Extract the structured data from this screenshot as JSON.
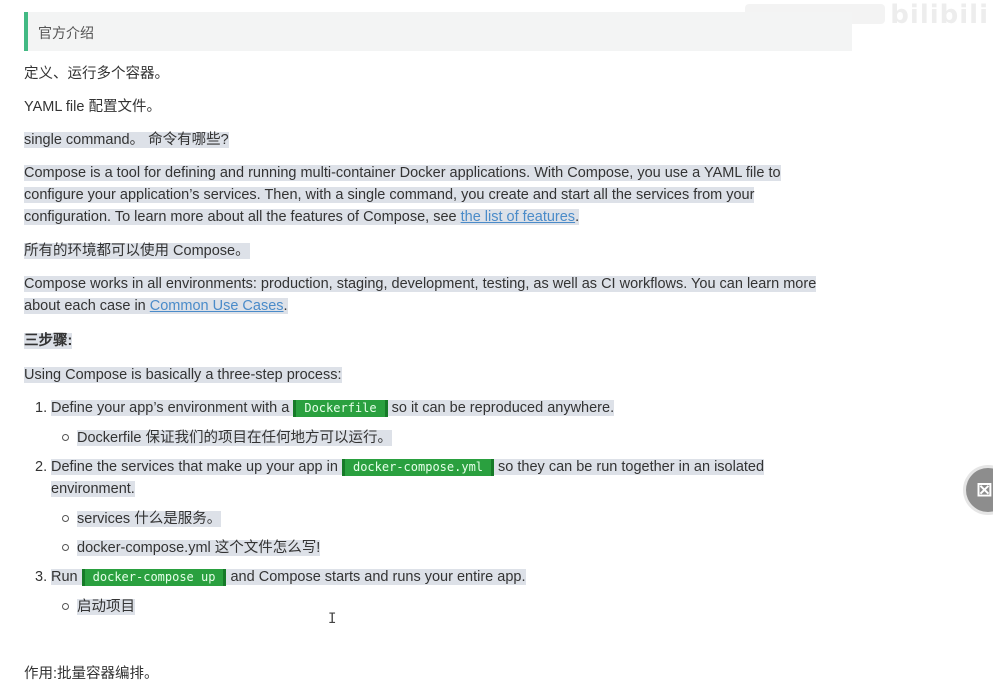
{
  "quote": "官方介绍",
  "p1": "定义、运行多个容器。",
  "p2": "YAML file 配置文件。",
  "p3": "single command。 命令有哪些?",
  "p4a": "Compose is a tool for defining and running multi-container Docker applications. With Compose, you use a YAML file to configure your application’s services. Then, with a single command, you create and start all the services from your configuration. To learn more about all the features of Compose, see ",
  "p4link": "the list of features",
  "p4b": ".",
  "p5": "所有的环境都可以使用 Compose。",
  "p6a": "Compose works in all environments: production, staging, development, testing, as well as CI workflows. You can learn more about each case in ",
  "p6link": "Common Use Cases",
  "p6b": ".",
  "h_steps": "三步骤:",
  "p7": "Using Compose is basically a three-step process:",
  "steps": [
    {
      "num": "1.",
      "pre": "Define your app’s environment with a ",
      "code": "Dockerfile",
      "post": " so it can be reproduced anywhere.",
      "subs": [
        "Dockerfile 保证我们的项目在任何地方可以运行。"
      ]
    },
    {
      "num": "2.",
      "pre": "Define the services that make up your app in ",
      "code": "docker-compose.yml",
      "post": " so they can be run together in an isolated environment.",
      "subs": [
        "services  什么是服务。",
        "docker-compose.yml 这个文件怎么写!"
      ]
    },
    {
      "num": "3.",
      "pre": "Run ",
      "code": "docker-compose up",
      "post": " and Compose starts and runs your entire app.",
      "subs": [
        "启动项目"
      ]
    }
  ],
  "footer": "作用:批量容器编排。",
  "watermark": "bilibili"
}
